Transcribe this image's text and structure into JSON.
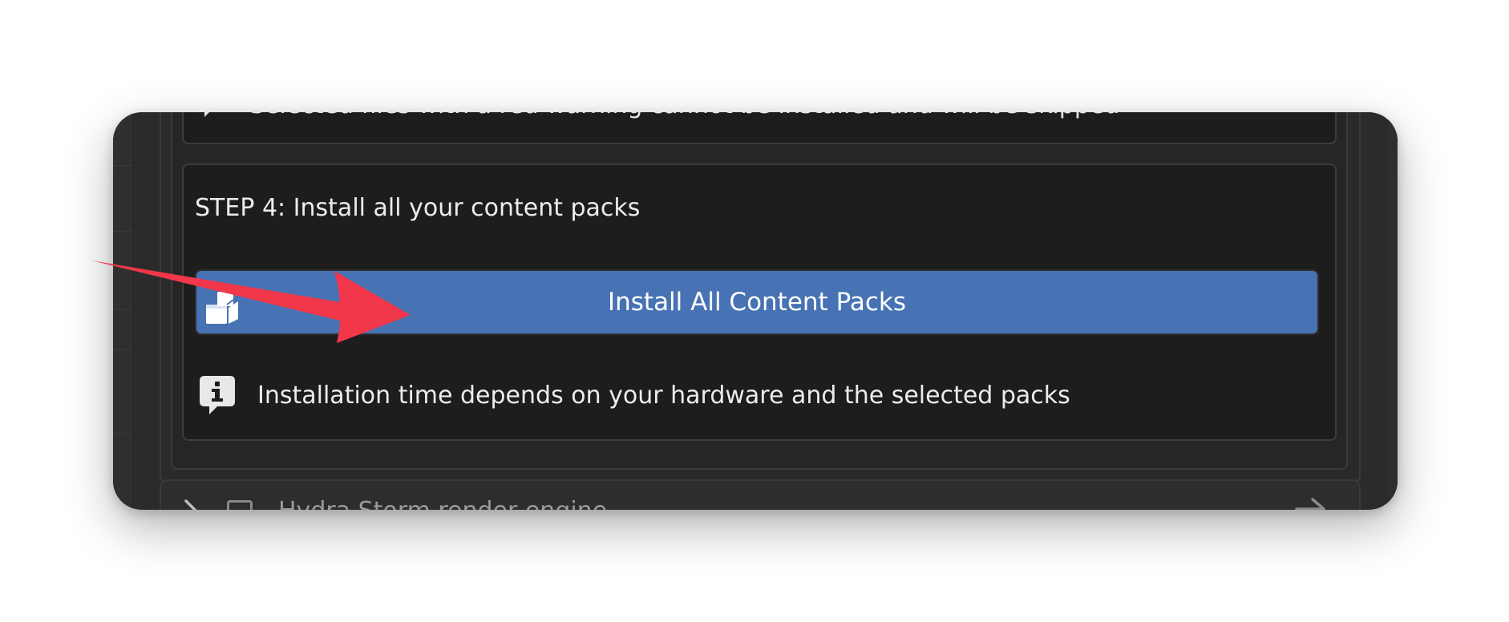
{
  "top_box": {
    "text": "Selected files with a red warning cannot be installed and will be skipped",
    "icon": "speech-bubble-icon"
  },
  "step4": {
    "title": "STEP 4: Install all your content packs",
    "install_button": {
      "label": "Install All Content Packs",
      "icon": "package-install-icon"
    },
    "info": {
      "text": "Installation time depends on your hardware and the selected packs",
      "icon": "info-icon"
    }
  },
  "hydra": {
    "label": "Hydra Storm render engine",
    "icons": [
      "chevron-right-icon",
      "checkbox-icon",
      "arrow-right-icon"
    ]
  },
  "colors": {
    "accent": "#4772b3",
    "annotation": "#f2374b",
    "panel": "#1d1d1d",
    "window": "#2b2b2b"
  }
}
